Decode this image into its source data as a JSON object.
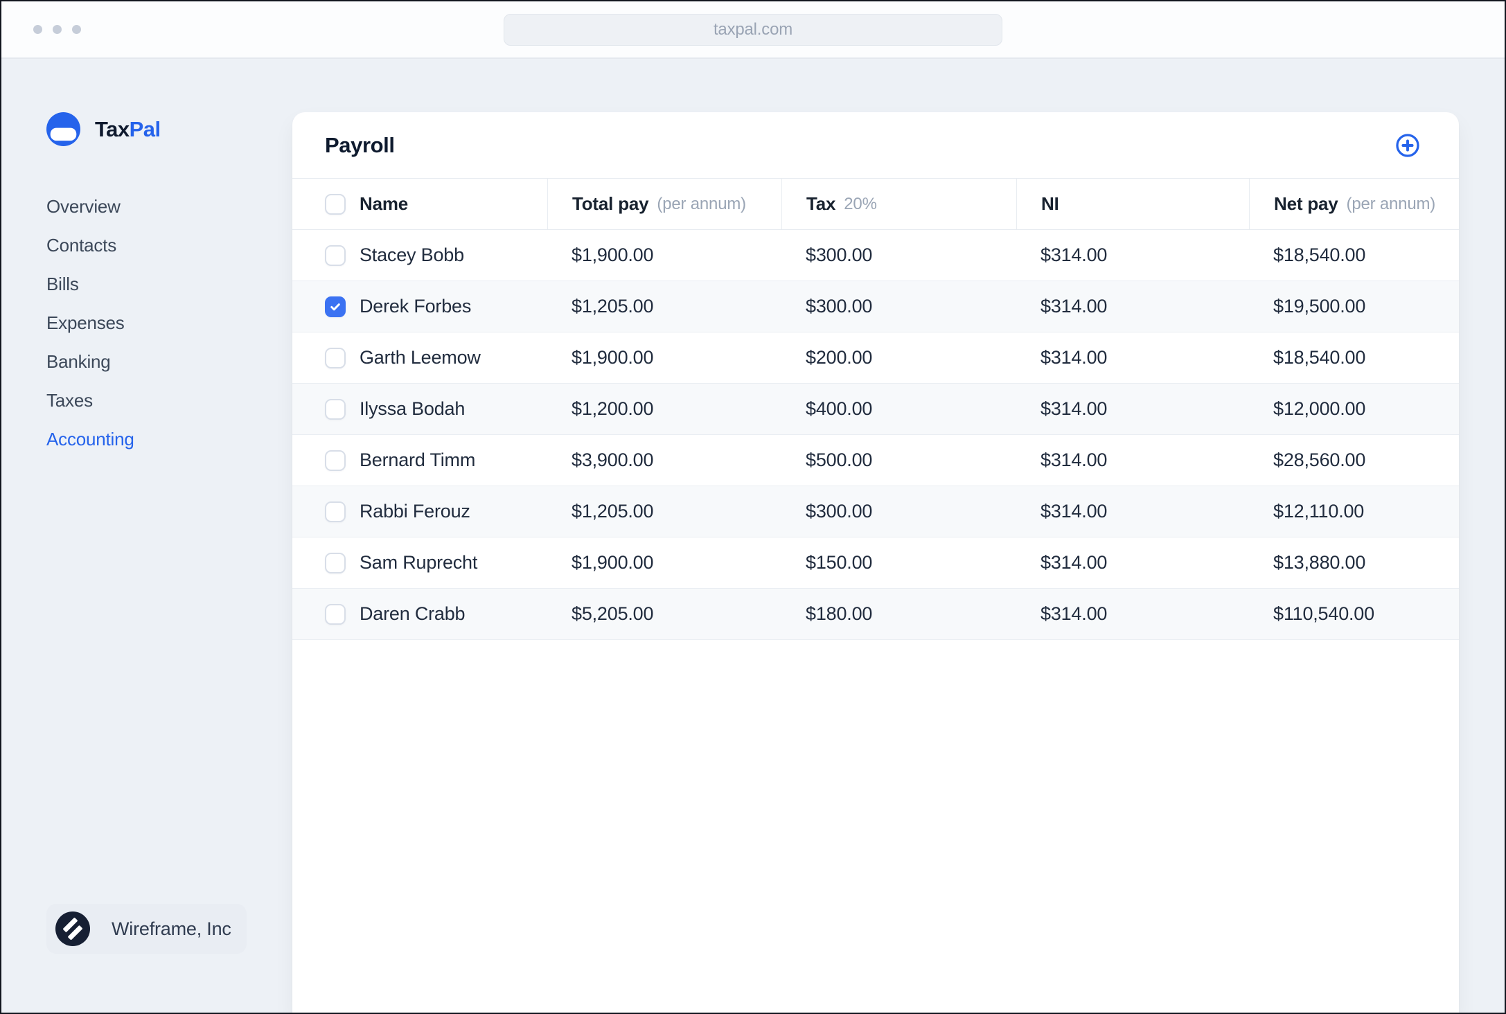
{
  "browser": {
    "url": "taxpal.com"
  },
  "sidebar": {
    "brand": {
      "first": "Tax",
      "second": "Pal"
    },
    "nav": [
      {
        "label": "Overview",
        "active": false
      },
      {
        "label": "Contacts",
        "active": false
      },
      {
        "label": "Bills",
        "active": false
      },
      {
        "label": "Expenses",
        "active": false
      },
      {
        "label": "Banking",
        "active": false
      },
      {
        "label": "Taxes",
        "active": false
      },
      {
        "label": "Accounting",
        "active": true
      }
    ],
    "organization": "Wireframe, Inc"
  },
  "payroll": {
    "title": "Payroll",
    "table": {
      "columns": [
        {
          "label": "Name",
          "sub": ""
        },
        {
          "label": "Total pay",
          "sub": "(per annum)"
        },
        {
          "label": "Tax",
          "sub": "20%"
        },
        {
          "label": "NI",
          "sub": ""
        },
        {
          "label": "Net pay",
          "sub": "(per annum)"
        }
      ],
      "rows": [
        {
          "name": "Stacey Bobb",
          "total_pay": "$1,900.00",
          "tax": "$300.00",
          "ni": "$314.00",
          "net_pay": "$18,540.00",
          "checked": false
        },
        {
          "name": "Derek Forbes",
          "total_pay": "$1,205.00",
          "tax": "$300.00",
          "ni": "$314.00",
          "net_pay": "$19,500.00",
          "checked": true
        },
        {
          "name": "Garth Leemow",
          "total_pay": "$1,900.00",
          "tax": "$200.00",
          "ni": "$314.00",
          "net_pay": "$18,540.00",
          "checked": false
        },
        {
          "name": "Ilyssa Bodah",
          "total_pay": "$1,200.00",
          "tax": "$400.00",
          "ni": "$314.00",
          "net_pay": "$12,000.00",
          "checked": false
        },
        {
          "name": "Bernard Timm",
          "total_pay": "$3,900.00",
          "tax": "$500.00",
          "ni": "$314.00",
          "net_pay": "$28,560.00",
          "checked": false
        },
        {
          "name": "Rabbi Ferouz",
          "total_pay": "$1,205.00",
          "tax": "$300.00",
          "ni": "$314.00",
          "net_pay": "$12,110.00",
          "checked": false
        },
        {
          "name": "Sam Ruprecht",
          "total_pay": "$1,900.00",
          "tax": "$150.00",
          "ni": "$314.00",
          "net_pay": "$13,880.00",
          "checked": false
        },
        {
          "name": "Daren Crabb",
          "total_pay": "$5,205.00",
          "tax": "$180.00",
          "ni": "$314.00",
          "net_pay": "$110,540.00",
          "checked": false
        }
      ]
    }
  },
  "icons": {
    "brand": "taxpal-logo-icon",
    "add": "plus-circle-icon",
    "organization": "wireframe-slash-icon",
    "row_selected": "checkmark-icon",
    "window_controls": "window-control-dots"
  },
  "colors": {
    "accent": "#2563eb",
    "checkbox_checked": "#3b72f2",
    "page_bg": "#edf1f6",
    "card_bg": "#ffffff",
    "row_alt_bg": "#f7f9fb",
    "badge_bg": "#e9edf3",
    "badge_circle": "#161f33",
    "text_dark": "#0e1a2e",
    "text_body": "#212c3e",
    "text_muted": "#9aa5b5"
  }
}
